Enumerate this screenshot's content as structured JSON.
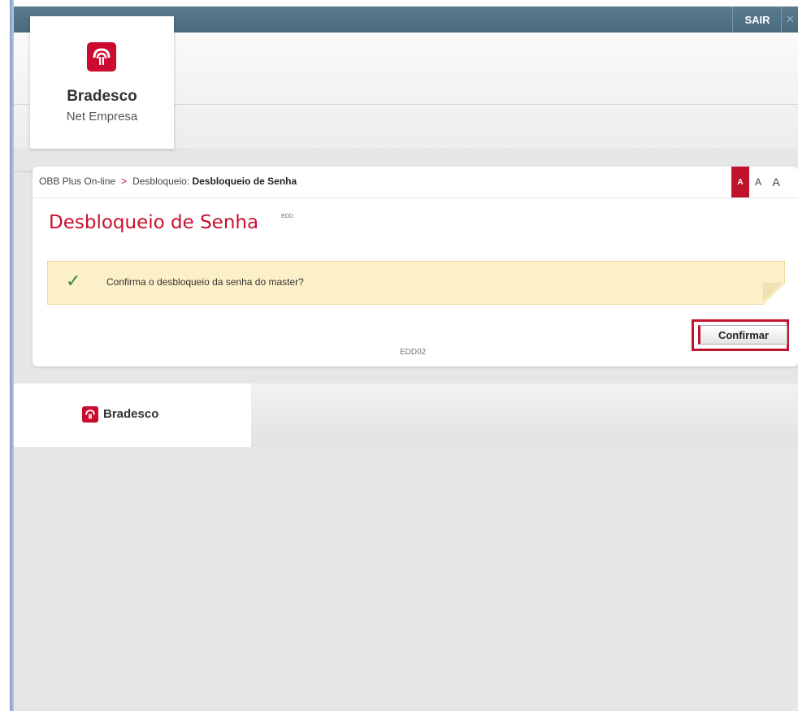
{
  "topbar": {
    "logout_label": "SAIR"
  },
  "brand": {
    "name": "Bradesco",
    "product": "Net Empresa"
  },
  "breadcrumb": {
    "root": "OBB Plus On-line",
    "separator": ">",
    "section": "Desbloqueio:",
    "current": "Desbloqueio de Senha"
  },
  "font_controls": {
    "small": "A",
    "medium": "A",
    "large": "A"
  },
  "page": {
    "title": "Desbloqueio de Senha",
    "title_code": "EDD",
    "screen_code": "EDD02"
  },
  "notice": {
    "message": "Confirma o desbloqueio da senha do master?"
  },
  "actions": {
    "confirm_label": "Confirmar"
  },
  "footer": {
    "brand_name": "Bradesco"
  },
  "colors": {
    "brand_red": "#cc092f",
    "topbar": "#4e6e82",
    "notice_bg": "#fbf0c8",
    "title_red": "#c8102e"
  },
  "icons": {
    "logo": "bradesco-tree-icon",
    "success": "checkmark-icon"
  }
}
